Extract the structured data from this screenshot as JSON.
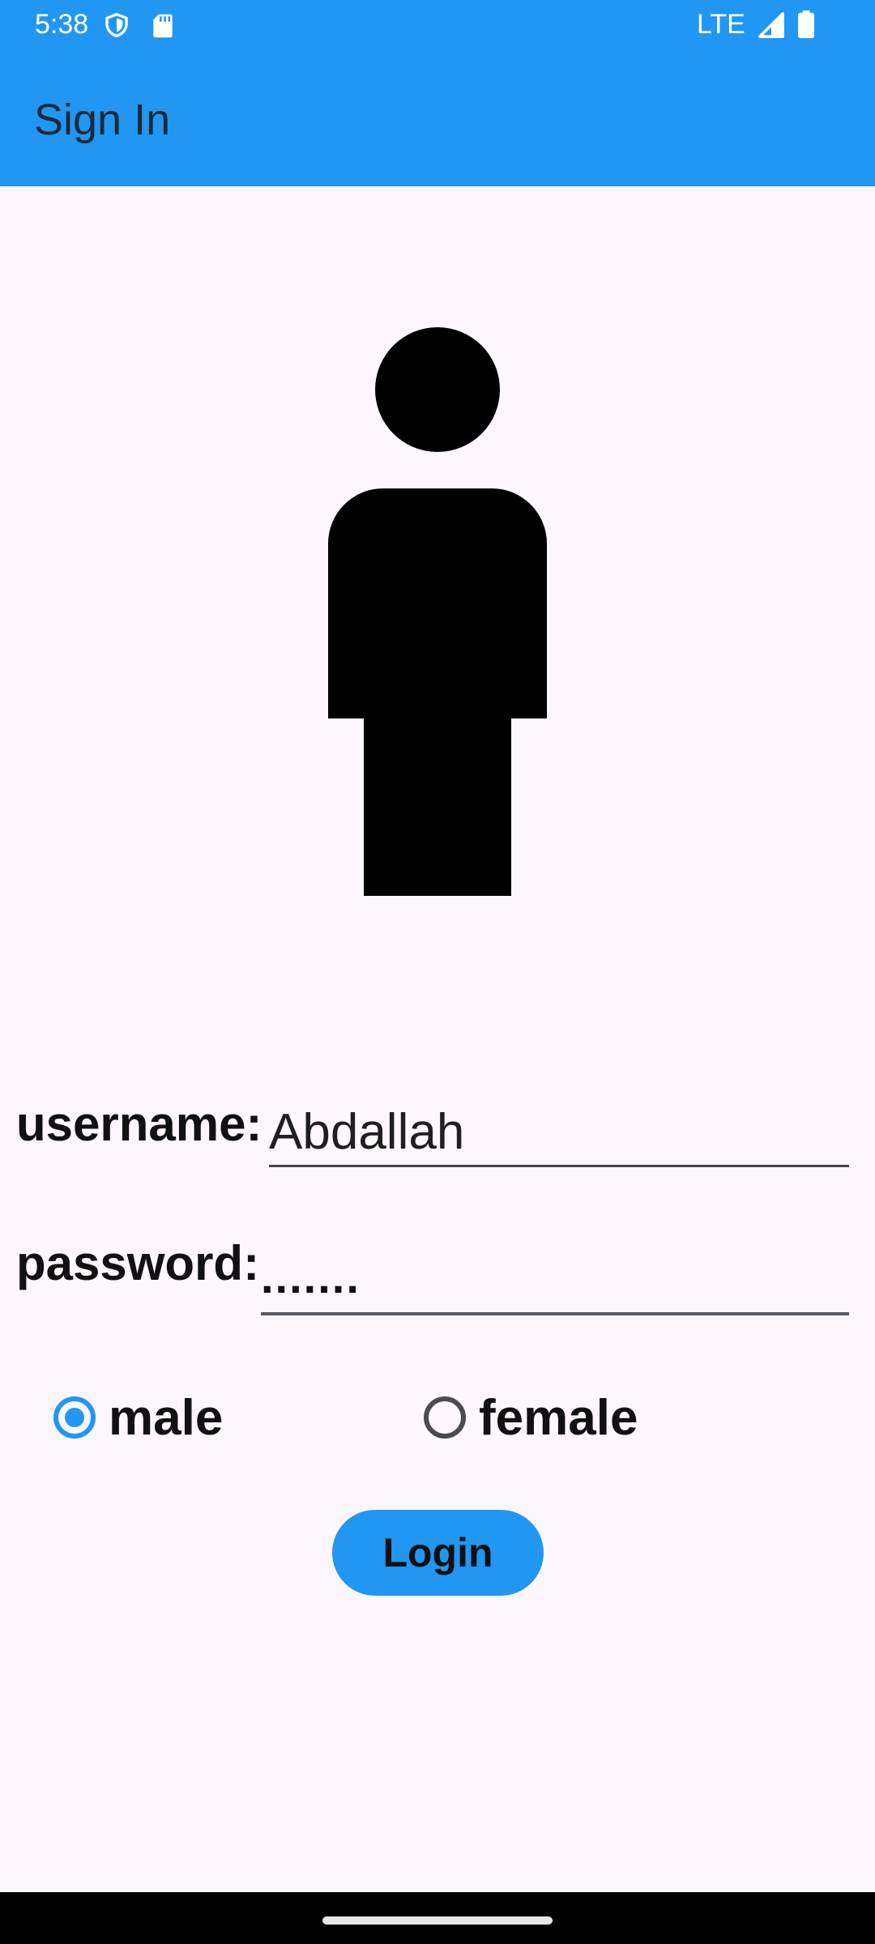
{
  "status_bar": {
    "time": "5:38",
    "network": "LTE",
    "icons": [
      "shield-icon",
      "sd-card-icon",
      "signal-icon",
      "battery-icon"
    ]
  },
  "app_bar": {
    "title": "Sign In",
    "background_color": "#2196f3"
  },
  "illustration": {
    "icon": "person-icon"
  },
  "form": {
    "username_label": "username:",
    "username_value": "Abdallah",
    "password_label": "password:",
    "password_value": ".......",
    "gender_options": [
      {
        "label": "male",
        "selected": true
      },
      {
        "label": "female",
        "selected": false
      }
    ],
    "login_label": "Login"
  },
  "colors": {
    "accent": "#2196f3",
    "background": "#fdf7fd"
  }
}
